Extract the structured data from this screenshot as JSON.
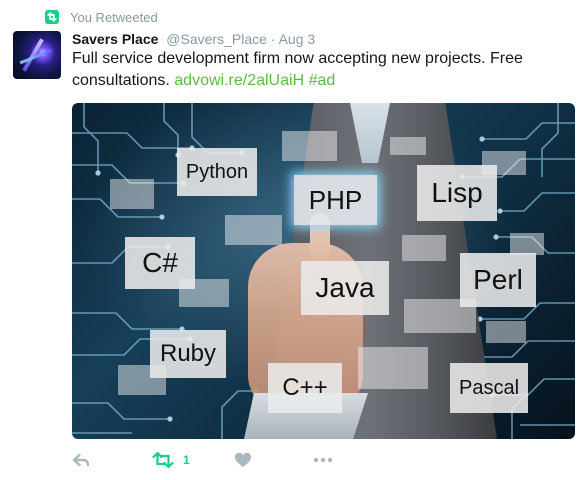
{
  "banner": {
    "text": "You Retweeted",
    "icon": "retweet-icon",
    "icon_color": "#19cf86"
  },
  "tweet": {
    "name": "Savers Place",
    "handle": "@Savers_Place",
    "separator": "·",
    "time": "Aug 3",
    "text_before": "Full service development firm now accepting new projects.  Free consultations. ",
    "link": "advowi.re/2alUaiH",
    "hashtag": "#ad",
    "link_color": "#5fb846"
  },
  "media": {
    "tags": [
      {
        "key": "python",
        "label": "Python"
      },
      {
        "key": "php",
        "label": "PHP"
      },
      {
        "key": "lisp",
        "label": "Lisp"
      },
      {
        "key": "csharp",
        "label": "C#"
      },
      {
        "key": "java",
        "label": "Java"
      },
      {
        "key": "perl",
        "label": "Perl"
      },
      {
        "key": "ruby",
        "label": "Ruby"
      },
      {
        "key": "cpp",
        "label": "C++"
      },
      {
        "key": "pascal",
        "label": "Pascal"
      }
    ]
  },
  "actions": {
    "reply_icon": "reply-icon",
    "retweet_icon": "retweet-icon",
    "retweet_count": "1",
    "like_icon": "heart-icon",
    "more_icon": "more-icon",
    "active_color": "#19cf86",
    "inactive_color": "#aab8c2"
  }
}
